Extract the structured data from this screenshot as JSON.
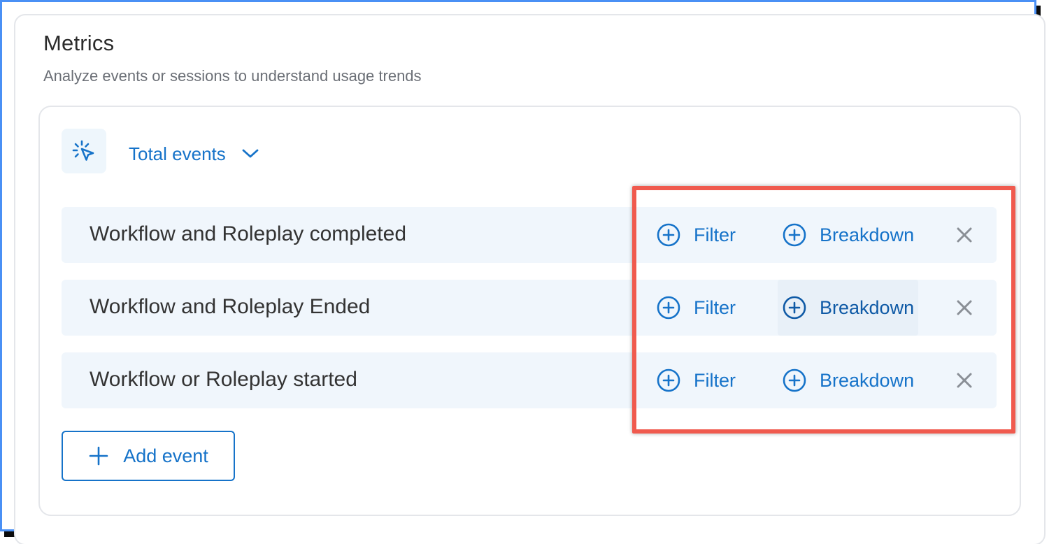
{
  "header": {
    "title": "Metrics",
    "subtitle": "Analyze events or sessions to understand usage trends"
  },
  "metric": {
    "icon": "cursor-click-icon",
    "selected": "Total events"
  },
  "events": [
    {
      "name": "Workflow and Roleplay completed"
    },
    {
      "name": "Workflow and Roleplay Ended"
    },
    {
      "name": "Workflow or Roleplay started"
    }
  ],
  "actions": {
    "filter_label": "Filter",
    "breakdown_label": "Breakdown"
  },
  "add_event": {
    "label": "Add event"
  },
  "colors": {
    "accent": "#1673c9",
    "row_bg": "#f0f6fc",
    "highlight": "#f05a4e",
    "frame": "#4a90f5"
  }
}
